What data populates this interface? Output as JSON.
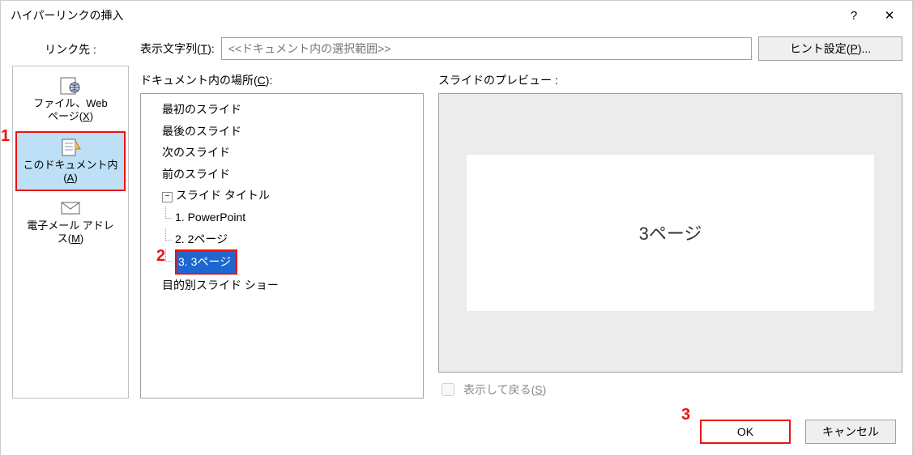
{
  "title": "ハイパーリンクの挿入",
  "titlebar": {
    "help": "?",
    "close": "✕"
  },
  "left": {
    "label": "リンク先 :",
    "items": [
      {
        "line1": "ファイル、Web",
        "line2": "ページ(X)",
        "key": "X"
      },
      {
        "line1": "このドキュメント内",
        "line2": "(A)",
        "key": "A"
      },
      {
        "line1": "電子メール アドレ",
        "line2": "ス(M)",
        "key": "M"
      }
    ]
  },
  "display": {
    "label": "表示文字列(T):",
    "placeholder": "<<ドキュメント内の選択範囲>>",
    "hint_btn": "ヒント設定(P)..."
  },
  "tree": {
    "label": "ドキュメント内の場所(C):",
    "items": {
      "first": "最初のスライド",
      "last": "最後のスライド",
      "next": "次のスライド",
      "prev": "前のスライド",
      "titles": "スライド タイトル",
      "s1": "1. PowerPoint",
      "s2": "2. 2ページ",
      "s3": "3. 3ページ",
      "custom": "目的別スライド ショー"
    }
  },
  "preview": {
    "label": "スライドのプレビュー :",
    "slide_text": "3ページ",
    "show_and_return": "表示して戻る(S)"
  },
  "footer": {
    "ok": "OK",
    "cancel": "キャンセル"
  },
  "callouts": {
    "c1": "1",
    "c2": "2",
    "c3": "3"
  }
}
